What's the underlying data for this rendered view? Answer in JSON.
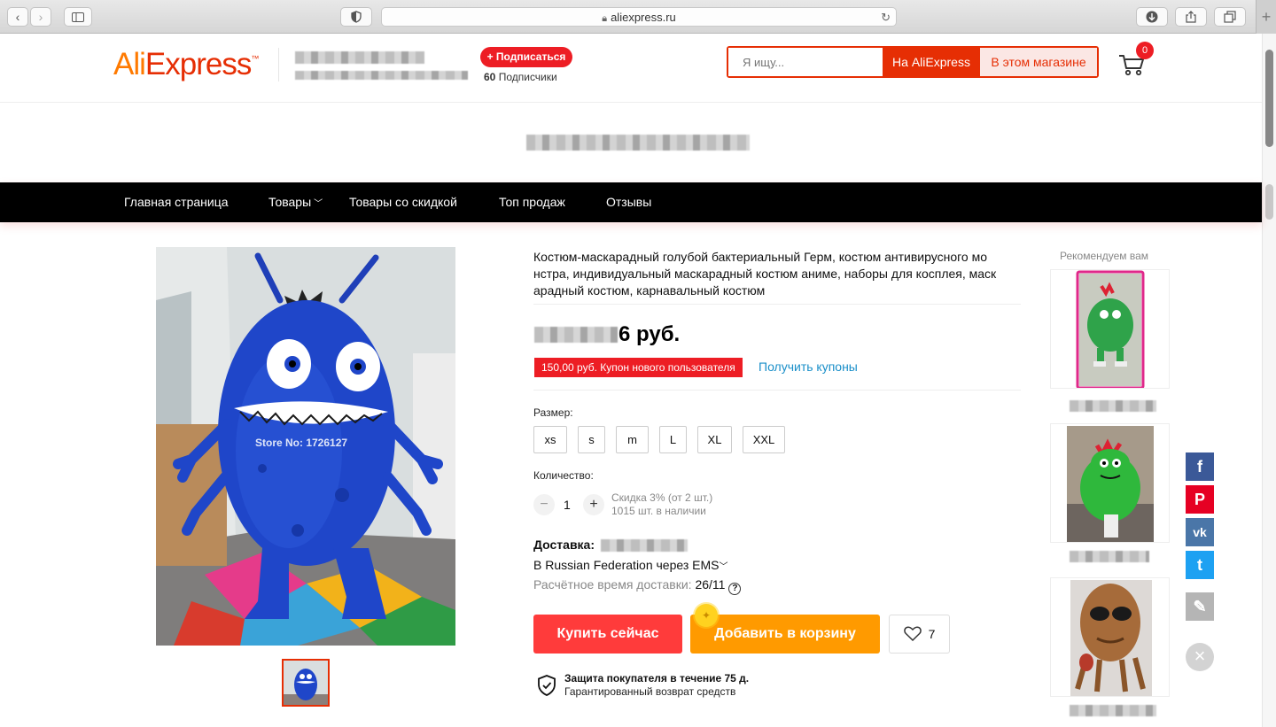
{
  "browser": {
    "url": "aliexpress.ru",
    "newtab_label": "+"
  },
  "header": {
    "logo_ali": "Ali",
    "logo_express": "Express",
    "logo_tm": "™",
    "subscribe_label": "+ Подписаться",
    "followers_count": "60",
    "followers_label": "Подписчики",
    "search_placeholder": "Я ищу...",
    "search_aliexpress_label": "На AliExpress",
    "search_store_label": "В этом магазине",
    "cart_count": "0"
  },
  "nav": {
    "items": [
      "Главная страница",
      "Товары",
      "Товары со скидкой",
      "Топ продаж",
      "Отзывы"
    ]
  },
  "product": {
    "image_watermark": "Store No: 1726127",
    "title": "Костюм-маскарадный голубой бактериальный Герм, костюм антивирусного мо нстра, индивидуальный маскарадный костюм аниме, наборы для косплея, маск арадный костюм, карнавальный костюм",
    "price_suffix": "6 руб.",
    "coupon_label": "150,00 руб. Купон нового пользователя",
    "coupon_link": "Получить купоны",
    "size_label": "Размер:",
    "sizes": [
      "xs",
      "s",
      "m",
      "L",
      "XL",
      "XXL"
    ],
    "quantity_label": "Количество:",
    "quantity_minus": "−",
    "quantity_value": "1",
    "quantity_plus": "+",
    "discount_info": "Скидка 3% (от 2 шт.)",
    "stock_info": "1015 шт. в наличии",
    "delivery_title": "Доставка:",
    "delivery_via": "В Russian Federation через EMS",
    "delivery_eta_label": "Расчётное время доставки:",
    "delivery_eta_value": "26/11",
    "buy_now": "Купить сейчас",
    "add_to_cart": "Добавить в корзину",
    "wishlist_count": "7",
    "protection_title": "Защита покупателя в течение 75 д.",
    "protection_sub": "Гарантированный возврат средств"
  },
  "recommend": {
    "title": "Рекомендуем вам"
  },
  "social": {
    "facebook": "f",
    "pinterest": "P",
    "vk": "vk",
    "twitter": "t",
    "edit": "✎",
    "close": "×"
  },
  "colors": {
    "brand_red": "#e62e04",
    "buy_red": "#ff3b3b",
    "cart_orange": "#ff9a00",
    "link_blue": "#1a8fc9"
  }
}
